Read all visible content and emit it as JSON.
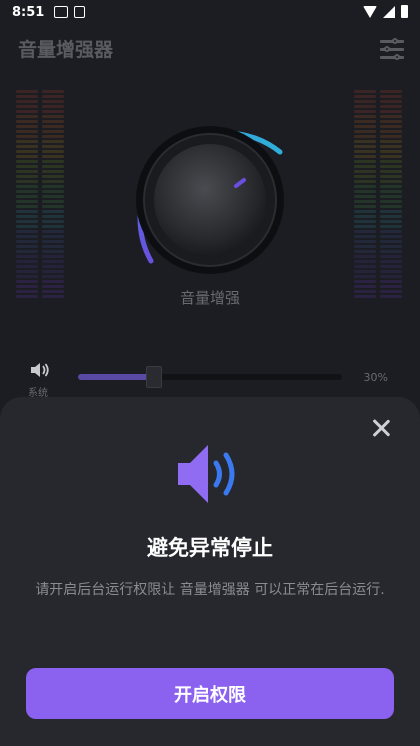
{
  "status_bar": {
    "time": "8:51",
    "indicator_1": "notification-icon",
    "indicator_2": "a-icon"
  },
  "header": {
    "title": "音量增强器",
    "settings_icon": "sliders-icon"
  },
  "booster": {
    "knob_label": "音量增强",
    "level_fraction": 0.0
  },
  "system_volume": {
    "label": "系统",
    "percent_text": "30%",
    "value": 0.3
  },
  "dialog": {
    "title": "避免异常停止",
    "description": "请开启后台运行权限让 音量增强器 可以正常在后台运行.",
    "button_label": "开启权限",
    "close_icon": "close-icon",
    "illustration_icon": "speaker-volume-icon"
  },
  "colors": {
    "accent": "#8b62f0",
    "ring_start": "#6a4ee0",
    "ring_end": "#2bb6d9",
    "speaker_purple": "#8f6cf2",
    "speaker_blue": "#3a79f0"
  }
}
